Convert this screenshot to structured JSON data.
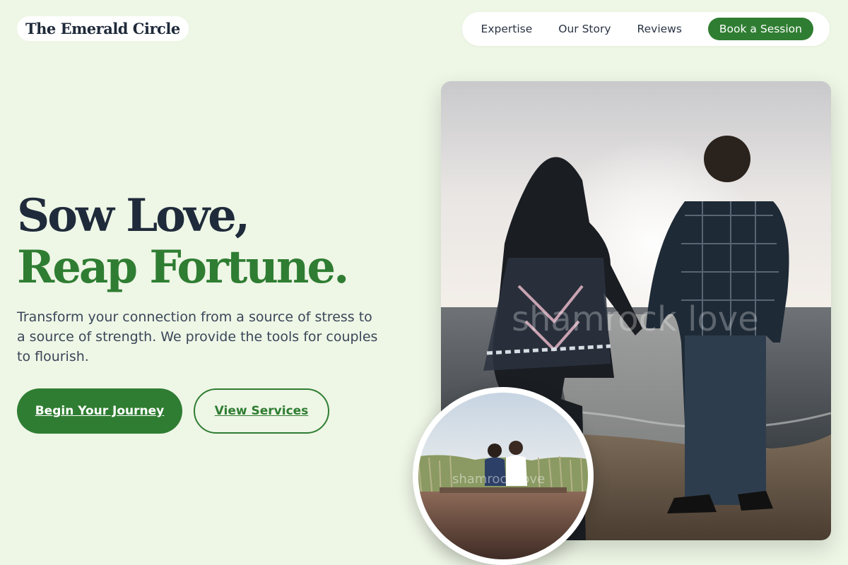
{
  "brand": {
    "name": "The Emerald Circle"
  },
  "nav": {
    "links": [
      "Expertise",
      "Our Story",
      "Reviews"
    ],
    "cta": "Book a Session"
  },
  "hero": {
    "headline_line1": "Sow Love,",
    "headline_line2": "Reap Fortune.",
    "description": "Transform your connection from a source of stress to a source of strength. We provide the tools for couples to flourish.",
    "primary_button": "Begin Your Journey",
    "secondary_button": "View Services",
    "main_image_watermark": "shamrock love",
    "inset_image_watermark": "shamrock love"
  },
  "colors": {
    "background": "#eef6e6",
    "accent": "#2f7d32",
    "heading": "#1f2a3a"
  },
  "images": {
    "main": "photo-icon: couple holding hands facing the ocean at sunset",
    "inset": "photo-icon: couple sitting on a wooden dock by tall grass"
  }
}
